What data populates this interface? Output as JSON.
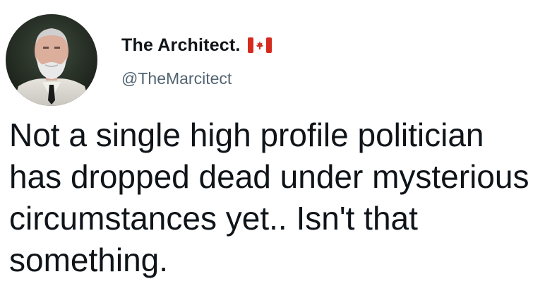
{
  "tweet": {
    "author": {
      "display_name": "The Architect.",
      "flag_icon": "canada-flag-icon",
      "handle": "@TheMarcitect"
    },
    "text": "Not a single high profile politician\nhas dropped dead under mysterious\ncircumstances yet.. Isn't that\nsomething."
  },
  "colors": {
    "text_primary": "#0f1419",
    "text_secondary": "#536471",
    "flag_red": "#d52b1e",
    "background": "#ffffff"
  }
}
